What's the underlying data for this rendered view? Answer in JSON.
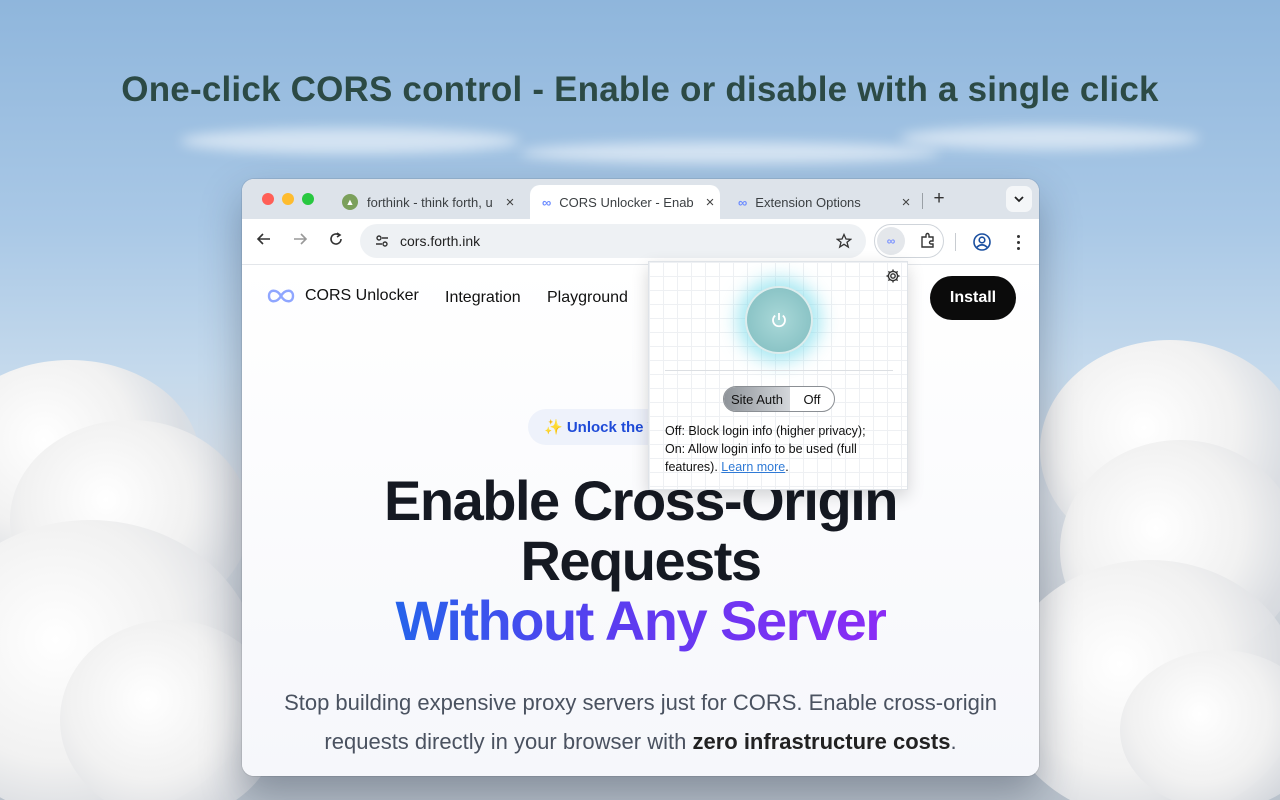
{
  "headline": "One-click CORS control - Enable or disable with a single click",
  "browser": {
    "tabs": [
      {
        "title": "forthink - think forth, u",
        "icon": "forthink-favicon",
        "active": false
      },
      {
        "title": "CORS Unlocker - Enab",
        "icon": "cors-unlocker-favicon",
        "active": true
      },
      {
        "title": "Extension Options",
        "icon": "cors-unlocker-favicon",
        "active": false
      }
    ],
    "new_tab": "+",
    "url": "cors.forth.ink"
  },
  "site": {
    "brand": "CORS Unlocker",
    "nav": [
      "Integration",
      "Playground"
    ],
    "install": "Install",
    "badge": "✨ Unlock the W",
    "hero_line1": "Enable Cross-Origin",
    "hero_line2": "Requests",
    "hero_line3": "Without Any Server",
    "sub_line1": "Stop building expensive proxy servers just for CORS. Enable cross-origin",
    "sub_line2_pre": "requests directly in your browser with",
    "sub_line2_bold": "zero infrastructure costs",
    "sub_line2_post": "."
  },
  "popup": {
    "toggle_label": "Site Auth",
    "toggle_value": "Off",
    "desc_off": "Off: Block login info (higher privacy);",
    "desc_on": "On: Allow login info to be used (full features).",
    "learn_more": "Learn more",
    "learn_more_post": ".",
    "power_state": "enabled"
  },
  "colors": {
    "headline": "#2c4a45",
    "accent_blue": "#2563eb",
    "accent_purple": "#8b2cf5",
    "glow": "#78dceb"
  }
}
